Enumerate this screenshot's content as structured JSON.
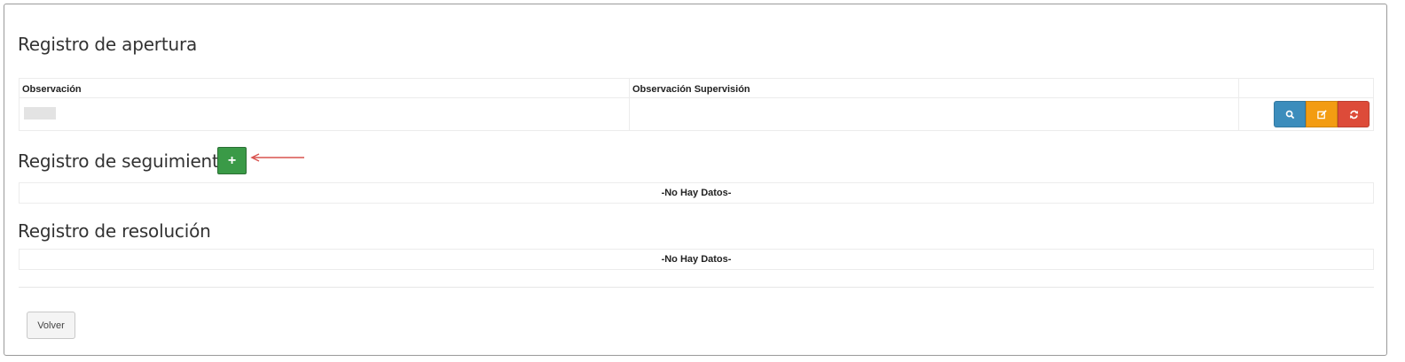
{
  "apertura": {
    "title": "Registro de apertura",
    "columns": [
      "Observación",
      "Observación Supervisión",
      ""
    ],
    "row": {
      "observacion": "",
      "observacion_supervision": ""
    },
    "actions": [
      {
        "icon": "search-icon",
        "color": "#3c8dbc"
      },
      {
        "icon": "edit-icon",
        "color": "#f39c12"
      },
      {
        "icon": "refresh-icon",
        "color": "#dd4b39"
      }
    ]
  },
  "seguimiento": {
    "title": "Registro de seguimiento",
    "add_label": "+",
    "empty_text": "-No Hay Datos-"
  },
  "resolucion": {
    "title": "Registro de resolución",
    "empty_text": "-No Hay Datos-"
  },
  "footer": {
    "back_label": "Volver"
  },
  "colors": {
    "add_button": "#3a9a47",
    "arrow": "#d9534f"
  }
}
